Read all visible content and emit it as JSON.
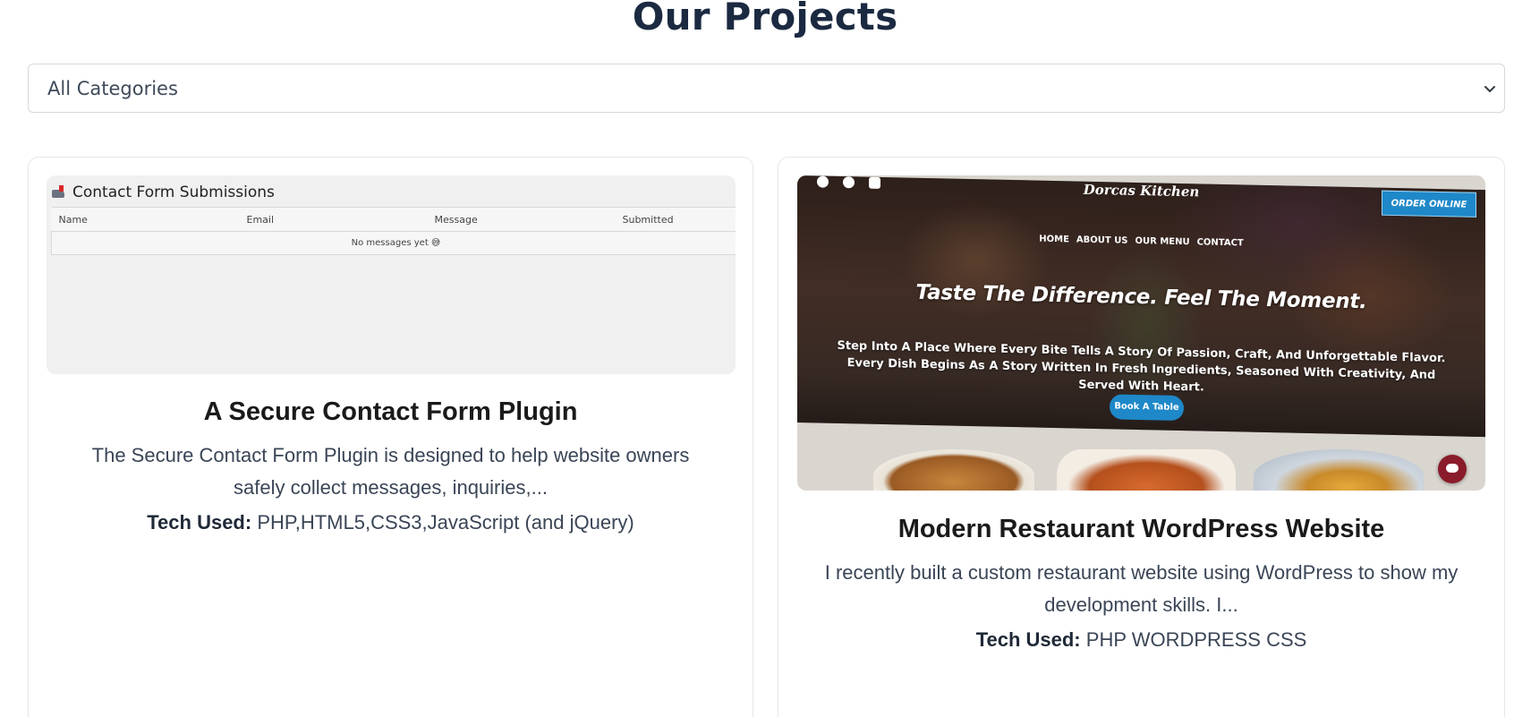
{
  "page": {
    "title": "Our Projects"
  },
  "filter": {
    "selected": "All Categories"
  },
  "projects": [
    {
      "title": "A Secure Contact Form Plugin",
      "description": "The Secure Contact Form Plugin is designed to help website owners safely collect messages, inquiries,...",
      "tech_label": "Tech Used:",
      "tech": "PHP,HTML5,CSS3,JavaScript (and jQuery)",
      "thumbnail": {
        "heading": "Contact Form Submissions",
        "heading_icon": "mailbox-icon",
        "columns": [
          "Name",
          "Email",
          "Message",
          "Submitted"
        ],
        "empty_text": "No messages yet 😅"
      }
    },
    {
      "title": "Modern Restaurant WordPress Website",
      "description": "I recently built a custom restaurant website using WordPress to show my development skills. I...",
      "tech_label": "Tech Used:",
      "tech": "PHP WORDPRESS CSS",
      "thumbnail": {
        "brand": "Dorcas Kitchen",
        "order_button": "ORDER ONLINE",
        "nav": [
          "HOME",
          "ABOUT US",
          "OUR MENU",
          "CONTACT"
        ],
        "headline": "Taste The Difference. Feel The Moment.",
        "subtext": "Step Into A Place Where Every Bite Tells A Story  Of Passion, Craft, And Unforgettable Flavor. Every Dish Begins As A Story Written In Fresh Ingredients, Seasoned With Creativity, And Served With Heart.",
        "book_button": "Book A Table",
        "social_icons": [
          "facebook-icon",
          "twitter-icon",
          "youtube-icon"
        ]
      }
    }
  ],
  "colors": {
    "heading": "#1b2a41",
    "accent_blue": "#1e88c9",
    "chat_bubble": "#8a1b2a"
  }
}
